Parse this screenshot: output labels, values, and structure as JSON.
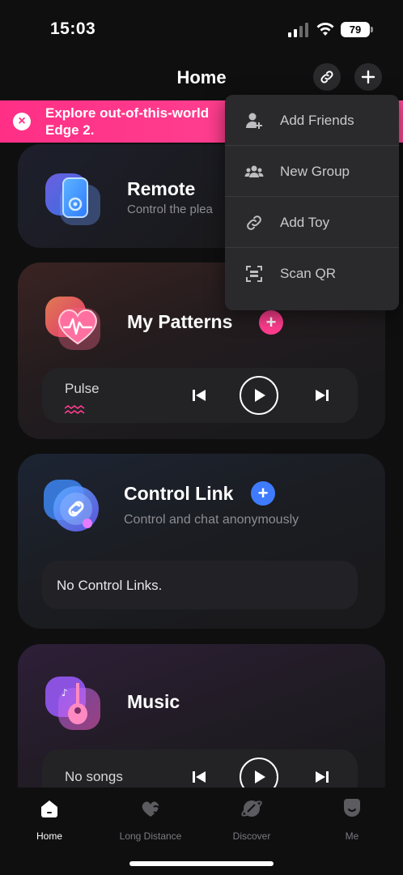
{
  "status_bar": {
    "time": "15:03",
    "battery": "79"
  },
  "header": {
    "title": "Home"
  },
  "banner": {
    "text": "Explore out-of-this-world Edge 2."
  },
  "cards": {
    "remote": {
      "title": "Remote",
      "subtitle": "Control the plea"
    },
    "patterns": {
      "title": "My Patterns",
      "player_label": "Pulse"
    },
    "control_link": {
      "title": "Control Link",
      "subtitle": "Control and chat anonymously",
      "empty_text": "No Control Links."
    },
    "music": {
      "title": "Music",
      "player_label": "No songs"
    }
  },
  "menu": {
    "items": [
      {
        "label": "Add Friends",
        "icon": "add-friend-icon"
      },
      {
        "label": "New Group",
        "icon": "group-icon"
      },
      {
        "label": "Add Toy",
        "icon": "link-icon"
      },
      {
        "label": "Scan QR",
        "icon": "scan-qr-icon"
      }
    ]
  },
  "tabbar": {
    "items": [
      {
        "label": "Home",
        "active": true
      },
      {
        "label": "Long Distance"
      },
      {
        "label": "Discover"
      },
      {
        "label": "Me"
      }
    ]
  },
  "colors": {
    "accent": "#ff2f86",
    "link_accent": "#3f7bff",
    "background": "#0f0f10"
  }
}
